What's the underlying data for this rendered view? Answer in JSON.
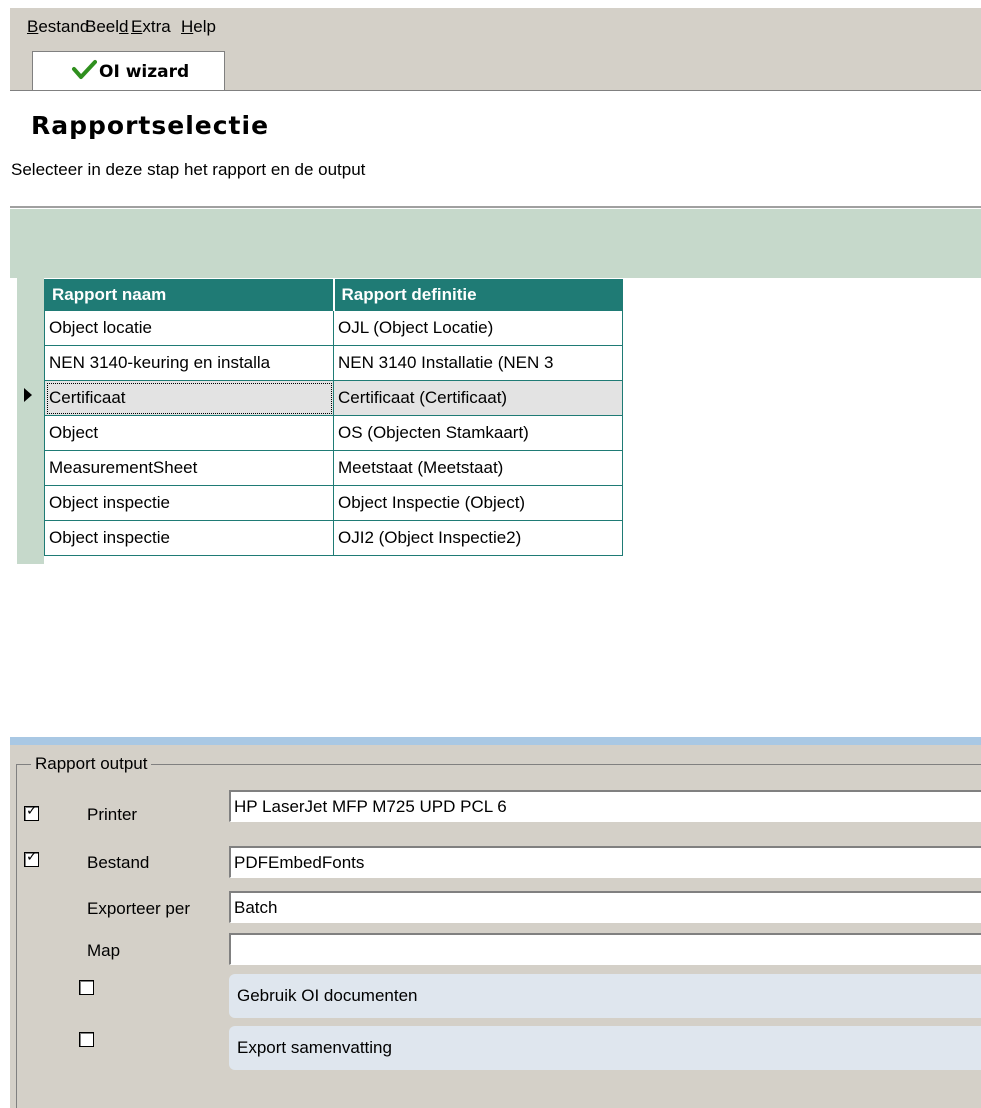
{
  "menu": {
    "items": [
      {
        "label": "Bestand",
        "mnemonic": "B"
      },
      {
        "label": "Beeld",
        "mnemonic": "d"
      },
      {
        "label": "Extra",
        "mnemonic": "E"
      },
      {
        "label": "Help",
        "mnemonic": "H"
      }
    ]
  },
  "tab": {
    "label": "OI wizard",
    "icon": "checkmark-icon",
    "accent": "#2f8f1e"
  },
  "header": {
    "title": "Rapportselectie",
    "subtitle": "Selecteer in deze stap het rapport en de output"
  },
  "grid": {
    "columns": [
      "Rapport naam",
      "Rapport definitie"
    ],
    "header_color": "#1f7b75",
    "selected_index": 2,
    "rows": [
      [
        "Object locatie",
        "OJL (Object Locatie)"
      ],
      [
        "NEN 3140-keuring en installa",
        "NEN 3140 Installatie (NEN 3"
      ],
      [
        "Certificaat",
        "Certificaat (Certificaat)"
      ],
      [
        "Object",
        "OS (Objecten Stamkaart)"
      ],
      [
        "MeasurementSheet",
        "Meetstaat (Meetstaat)"
      ],
      [
        "Object inspectie",
        "Object Inspectie (Object)"
      ],
      [
        "Object inspectie",
        "OJI2 (Object Inspectie2)"
      ]
    ]
  },
  "output": {
    "group_label": "Rapport output",
    "printer": {
      "checked": true,
      "label": "Printer",
      "value": "HP LaserJet MFP M725 UPD PCL 6"
    },
    "bestand": {
      "checked": true,
      "label": "Bestand",
      "value": "PDFEmbedFonts"
    },
    "exporteer_per": {
      "label": "Exporteer per",
      "value": "Batch"
    },
    "map": {
      "label": "Map",
      "value": ""
    },
    "gebruik_oi": {
      "checked": false,
      "label": "Gebruik OI documenten"
    },
    "export_samenvatting": {
      "checked": false,
      "label": "Export samenvatting"
    }
  }
}
